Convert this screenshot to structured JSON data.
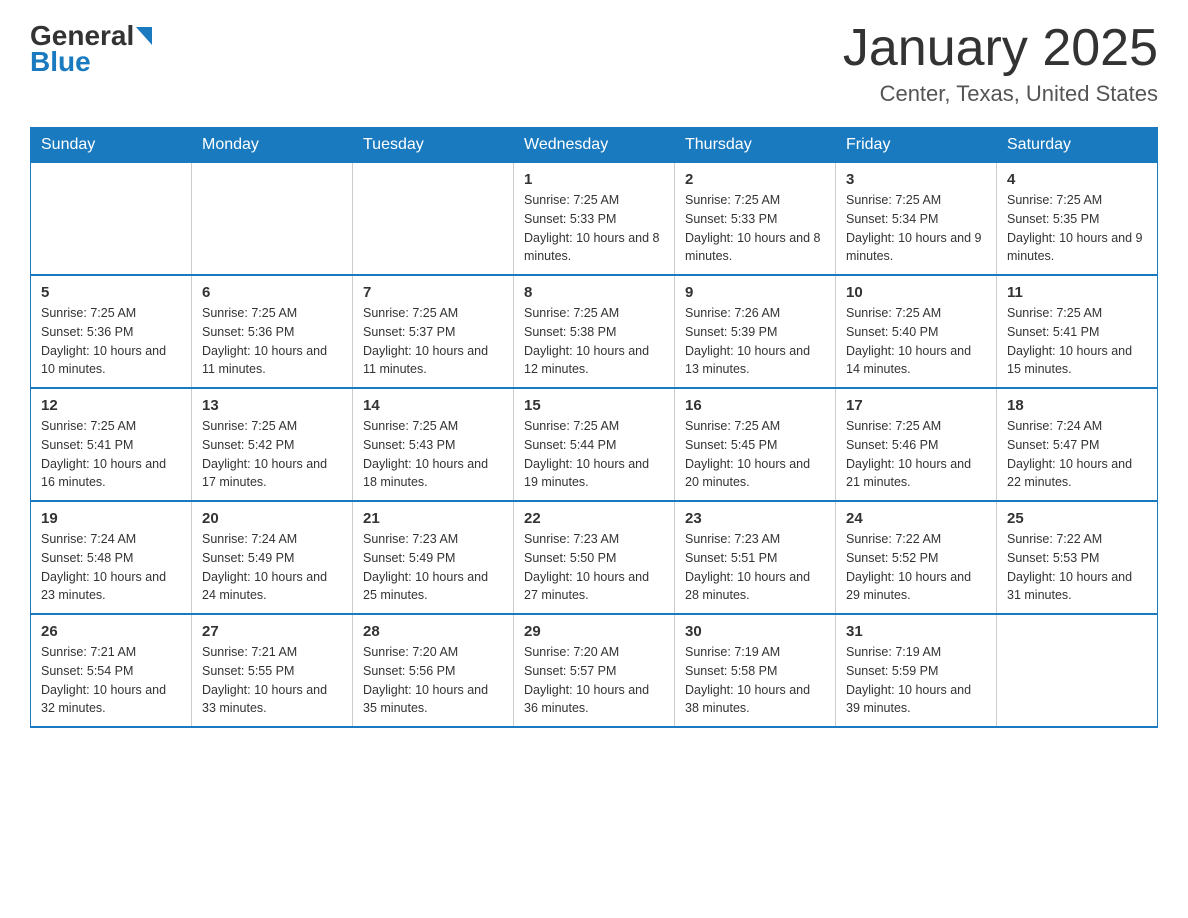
{
  "header": {
    "logo": {
      "general": "General",
      "blue": "Blue",
      "tagline": "GeneralBlue"
    },
    "title": "January 2025",
    "subtitle": "Center, Texas, United States"
  },
  "calendar": {
    "headers": [
      "Sunday",
      "Monday",
      "Tuesday",
      "Wednesday",
      "Thursday",
      "Friday",
      "Saturday"
    ],
    "rows": [
      [
        {
          "day": "",
          "info": ""
        },
        {
          "day": "",
          "info": ""
        },
        {
          "day": "",
          "info": ""
        },
        {
          "day": "1",
          "info": "Sunrise: 7:25 AM\nSunset: 5:33 PM\nDaylight: 10 hours and 8 minutes."
        },
        {
          "day": "2",
          "info": "Sunrise: 7:25 AM\nSunset: 5:33 PM\nDaylight: 10 hours and 8 minutes."
        },
        {
          "day": "3",
          "info": "Sunrise: 7:25 AM\nSunset: 5:34 PM\nDaylight: 10 hours and 9 minutes."
        },
        {
          "day": "4",
          "info": "Sunrise: 7:25 AM\nSunset: 5:35 PM\nDaylight: 10 hours and 9 minutes."
        }
      ],
      [
        {
          "day": "5",
          "info": "Sunrise: 7:25 AM\nSunset: 5:36 PM\nDaylight: 10 hours and 10 minutes."
        },
        {
          "day": "6",
          "info": "Sunrise: 7:25 AM\nSunset: 5:36 PM\nDaylight: 10 hours and 11 minutes."
        },
        {
          "day": "7",
          "info": "Sunrise: 7:25 AM\nSunset: 5:37 PM\nDaylight: 10 hours and 11 minutes."
        },
        {
          "day": "8",
          "info": "Sunrise: 7:25 AM\nSunset: 5:38 PM\nDaylight: 10 hours and 12 minutes."
        },
        {
          "day": "9",
          "info": "Sunrise: 7:26 AM\nSunset: 5:39 PM\nDaylight: 10 hours and 13 minutes."
        },
        {
          "day": "10",
          "info": "Sunrise: 7:25 AM\nSunset: 5:40 PM\nDaylight: 10 hours and 14 minutes."
        },
        {
          "day": "11",
          "info": "Sunrise: 7:25 AM\nSunset: 5:41 PM\nDaylight: 10 hours and 15 minutes."
        }
      ],
      [
        {
          "day": "12",
          "info": "Sunrise: 7:25 AM\nSunset: 5:41 PM\nDaylight: 10 hours and 16 minutes."
        },
        {
          "day": "13",
          "info": "Sunrise: 7:25 AM\nSunset: 5:42 PM\nDaylight: 10 hours and 17 minutes."
        },
        {
          "day": "14",
          "info": "Sunrise: 7:25 AM\nSunset: 5:43 PM\nDaylight: 10 hours and 18 minutes."
        },
        {
          "day": "15",
          "info": "Sunrise: 7:25 AM\nSunset: 5:44 PM\nDaylight: 10 hours and 19 minutes."
        },
        {
          "day": "16",
          "info": "Sunrise: 7:25 AM\nSunset: 5:45 PM\nDaylight: 10 hours and 20 minutes."
        },
        {
          "day": "17",
          "info": "Sunrise: 7:25 AM\nSunset: 5:46 PM\nDaylight: 10 hours and 21 minutes."
        },
        {
          "day": "18",
          "info": "Sunrise: 7:24 AM\nSunset: 5:47 PM\nDaylight: 10 hours and 22 minutes."
        }
      ],
      [
        {
          "day": "19",
          "info": "Sunrise: 7:24 AM\nSunset: 5:48 PM\nDaylight: 10 hours and 23 minutes."
        },
        {
          "day": "20",
          "info": "Sunrise: 7:24 AM\nSunset: 5:49 PM\nDaylight: 10 hours and 24 minutes."
        },
        {
          "day": "21",
          "info": "Sunrise: 7:23 AM\nSunset: 5:49 PM\nDaylight: 10 hours and 25 minutes."
        },
        {
          "day": "22",
          "info": "Sunrise: 7:23 AM\nSunset: 5:50 PM\nDaylight: 10 hours and 27 minutes."
        },
        {
          "day": "23",
          "info": "Sunrise: 7:23 AM\nSunset: 5:51 PM\nDaylight: 10 hours and 28 minutes."
        },
        {
          "day": "24",
          "info": "Sunrise: 7:22 AM\nSunset: 5:52 PM\nDaylight: 10 hours and 29 minutes."
        },
        {
          "day": "25",
          "info": "Sunrise: 7:22 AM\nSunset: 5:53 PM\nDaylight: 10 hours and 31 minutes."
        }
      ],
      [
        {
          "day": "26",
          "info": "Sunrise: 7:21 AM\nSunset: 5:54 PM\nDaylight: 10 hours and 32 minutes."
        },
        {
          "day": "27",
          "info": "Sunrise: 7:21 AM\nSunset: 5:55 PM\nDaylight: 10 hours and 33 minutes."
        },
        {
          "day": "28",
          "info": "Sunrise: 7:20 AM\nSunset: 5:56 PM\nDaylight: 10 hours and 35 minutes."
        },
        {
          "day": "29",
          "info": "Sunrise: 7:20 AM\nSunset: 5:57 PM\nDaylight: 10 hours and 36 minutes."
        },
        {
          "day": "30",
          "info": "Sunrise: 7:19 AM\nSunset: 5:58 PM\nDaylight: 10 hours and 38 minutes."
        },
        {
          "day": "31",
          "info": "Sunrise: 7:19 AM\nSunset: 5:59 PM\nDaylight: 10 hours and 39 minutes."
        },
        {
          "day": "",
          "info": ""
        }
      ]
    ]
  }
}
